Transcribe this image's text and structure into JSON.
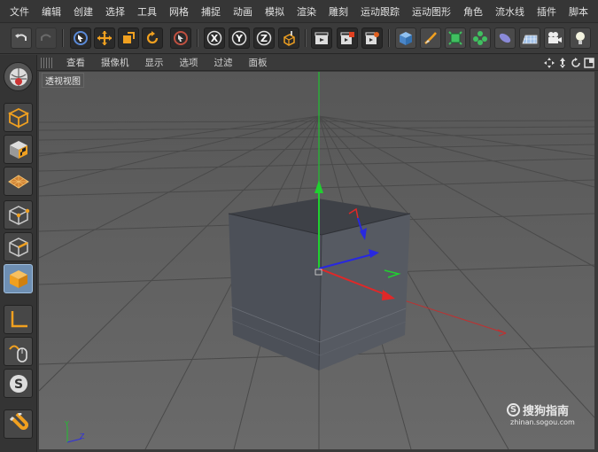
{
  "menu": {
    "items": [
      "文件",
      "编辑",
      "创建",
      "选择",
      "工具",
      "网格",
      "捕捉",
      "动画",
      "模拟",
      "渲染",
      "雕刻",
      "运动跟踪",
      "运动图形",
      "角色",
      "流水线",
      "插件",
      "脚本"
    ]
  },
  "viewport": {
    "menu": [
      "查看",
      "摄像机",
      "显示",
      "选项",
      "过滤",
      "面板"
    ],
    "label": "透视视图"
  },
  "toolbar": {
    "axis_x": "X",
    "axis_y": "Y",
    "axis_z": "Z"
  },
  "axis_indicator": {
    "y": "Y",
    "z": "Z"
  },
  "watermark": {
    "title": "搜狗指南",
    "url": "zhinan.sogou.com"
  },
  "colors": {
    "accent_blue": "#6e8fb3",
    "axis_x": "#d83030",
    "axis_y": "#20c030",
    "axis_z": "#3030e0",
    "tool_orange": "#f0a020"
  }
}
